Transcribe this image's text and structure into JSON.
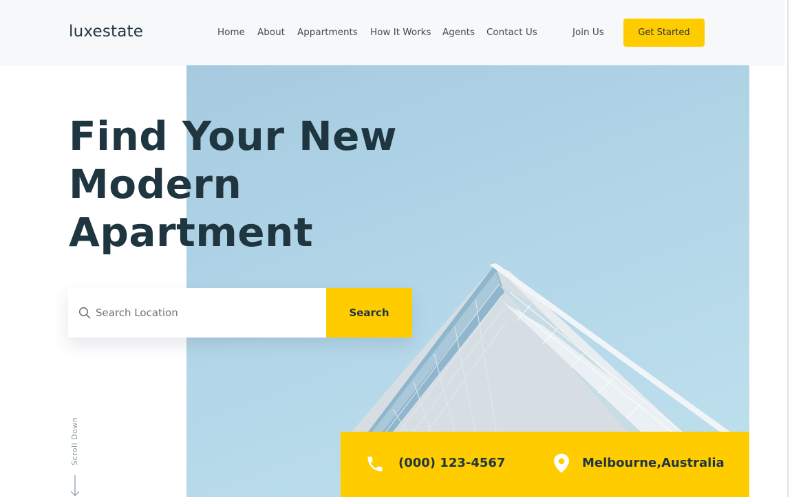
{
  "header": {
    "logo": "luxestate",
    "nav": [
      {
        "label": "Home"
      },
      {
        "label": "About"
      },
      {
        "label": "Appartments"
      },
      {
        "label": "How It Works"
      },
      {
        "label": "Agents"
      },
      {
        "label": "Contact Us"
      }
    ],
    "join_label": "Join Us",
    "cta_label": "Get Started"
  },
  "hero": {
    "title_line1": "Find Your New",
    "title_line2": "Modern",
    "title_line3": "Apartment"
  },
  "search": {
    "placeholder": "Search Location",
    "button_label": "Search"
  },
  "scroll": {
    "label": "Scroll Down"
  },
  "contact": {
    "phone": "(000) 123-4567",
    "location": "Melbourne,Australia"
  },
  "icons": {
    "search": "search-icon",
    "phone": "phone-icon",
    "location": "map-pin-icon",
    "arrow": "arrow-down-icon"
  },
  "colors": {
    "accent": "#ffcc00",
    "text_dark": "#1f3540",
    "sky": "#b2d6e8",
    "header_bg": "#f7f8fa"
  }
}
